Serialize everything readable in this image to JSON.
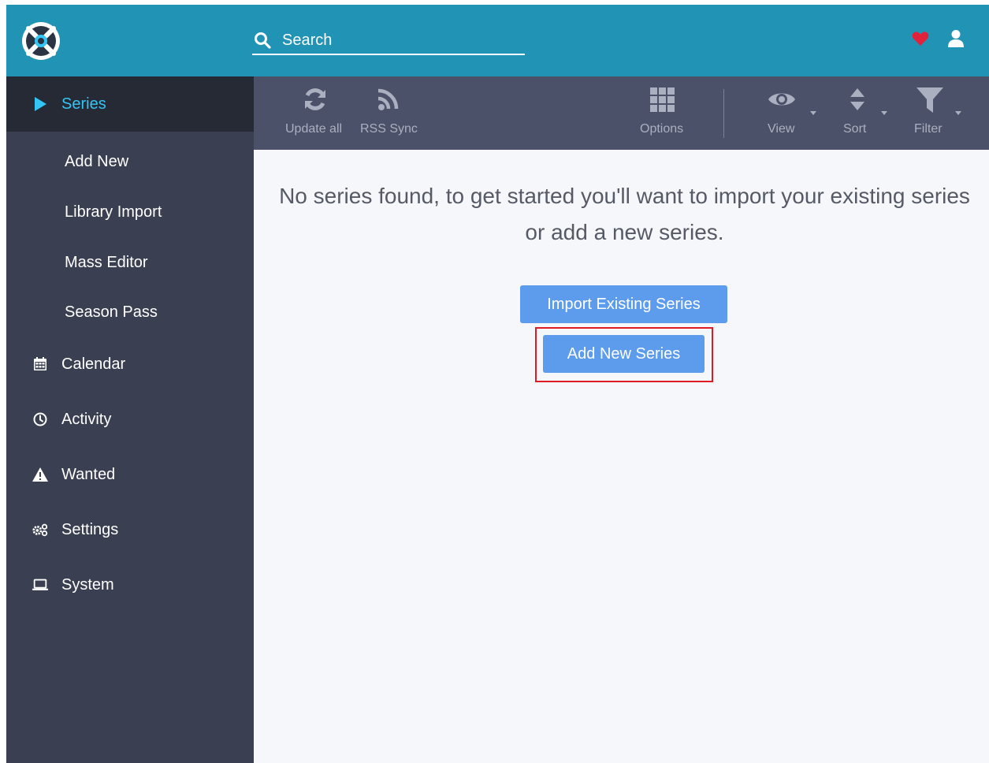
{
  "header": {
    "search": {
      "placeholder": "Search",
      "value": ""
    },
    "logo_icon": "sonarr-logo-icon",
    "heart_icon": "heart-icon",
    "user_icon": "user-icon",
    "colors": {
      "background": "#2193b5",
      "heart": "#e0223a"
    }
  },
  "sidebar": {
    "items": [
      {
        "label": "Series",
        "icon": "play-icon",
        "active": true
      },
      {
        "label": "Add New",
        "sub": true
      },
      {
        "label": "Library Import",
        "sub": true
      },
      {
        "label": "Mass Editor",
        "sub": true
      },
      {
        "label": "Season Pass",
        "sub": true
      },
      {
        "label": "Calendar",
        "icon": "calendar-icon"
      },
      {
        "label": "Activity",
        "icon": "clock-icon"
      },
      {
        "label": "Wanted",
        "icon": "warning-icon"
      },
      {
        "label": "Settings",
        "icon": "gears-icon"
      },
      {
        "label": "System",
        "icon": "laptop-icon"
      }
    ],
    "colors": {
      "background": "#3a3f51",
      "active_background": "#262a35",
      "active_text": "#35c5f4"
    }
  },
  "toolbar": {
    "update_all": "Update all",
    "rss_sync": "RSS Sync",
    "options": "Options",
    "view": "View",
    "sort": "Sort",
    "filter": "Filter",
    "colors": {
      "background": "#4a5168",
      "icon": "#aab0c0"
    }
  },
  "main": {
    "empty_message": "No series found, to get started you'll want to import your existing series or add a new series.",
    "import_button": "Import Existing Series",
    "add_button": "Add New Series",
    "colors": {
      "button": "#5d9cec",
      "highlight": "#e01b24"
    }
  }
}
